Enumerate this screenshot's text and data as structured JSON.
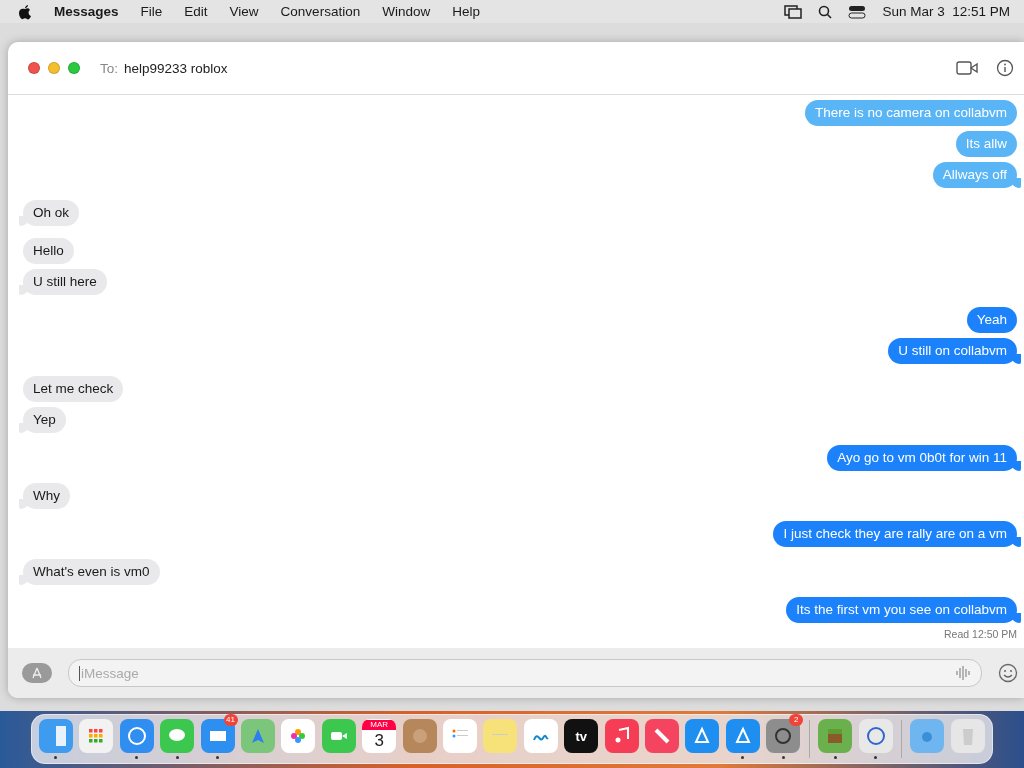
{
  "menu_bar": {
    "app": "Messages",
    "menus": [
      "File",
      "Edit",
      "View",
      "Conversation",
      "Window",
      "Help"
    ],
    "date": "Sun Mar 3",
    "time": "12:51 PM"
  },
  "window": {
    "to_label": "To:",
    "recipient": "help99233 roblox"
  },
  "message_groups": [
    {
      "messages": [
        {
          "kind": "sent",
          "text": "There is no camera on collabvm",
          "faded": true,
          "tail": false
        },
        {
          "kind": "sent",
          "text": "Its allw",
          "faded": true,
          "tail": false
        },
        {
          "kind": "sent",
          "text": "Allways off",
          "faded": true,
          "tail": true
        }
      ]
    },
    {
      "messages": [
        {
          "kind": "received",
          "text": "Oh ok",
          "tail": true
        }
      ]
    },
    {
      "messages": [
        {
          "kind": "received",
          "text": "Hello",
          "tail": false
        },
        {
          "kind": "received",
          "text": "U still here",
          "tail": true
        }
      ]
    },
    {
      "messages": [
        {
          "kind": "sent",
          "text": "Yeah",
          "faded": false,
          "tail": false
        },
        {
          "kind": "sent",
          "text": "U still on collabvm",
          "faded": false,
          "tail": true
        }
      ]
    },
    {
      "messages": [
        {
          "kind": "received",
          "text": "Let me check",
          "tail": false
        },
        {
          "kind": "received",
          "text": "Yep",
          "tail": true
        }
      ]
    },
    {
      "messages": [
        {
          "kind": "sent",
          "text": "Ayo go to vm 0b0t for win 11",
          "faded": false,
          "tail": true
        }
      ]
    },
    {
      "messages": [
        {
          "kind": "received",
          "text": "Why",
          "tail": true
        }
      ]
    },
    {
      "messages": [
        {
          "kind": "sent",
          "text": "I just check they are rally are on a vm",
          "faded": false,
          "tail": true
        }
      ]
    },
    {
      "messages": [
        {
          "kind": "received",
          "text": "What's even is vm0",
          "tail": true
        }
      ]
    },
    {
      "messages": [
        {
          "kind": "sent",
          "text": "Its the first vm you see on collabvm",
          "faded": false,
          "tail": true
        }
      ]
    }
  ],
  "read_receipt": "Read 12:50 PM",
  "composer": {
    "placeholder": "iMessage"
  },
  "dock": [
    {
      "kind": "finder",
      "running": true
    },
    {
      "kind": "launchpad",
      "running": false
    },
    {
      "kind": "safari",
      "running": true
    },
    {
      "kind": "messages",
      "running": true
    },
    {
      "kind": "mail",
      "running": true,
      "badge": "41"
    },
    {
      "kind": "maps",
      "running": false
    },
    {
      "kind": "photos",
      "running": false
    },
    {
      "kind": "facetime",
      "running": false
    },
    {
      "kind": "calendar",
      "running": false,
      "month": "MAR",
      "day": "3"
    },
    {
      "kind": "contacts",
      "running": false
    },
    {
      "kind": "reminders",
      "running": false
    },
    {
      "kind": "notes",
      "running": false
    },
    {
      "kind": "freeform",
      "running": false
    },
    {
      "kind": "tv",
      "running": false,
      "label": "tv"
    },
    {
      "kind": "music",
      "running": false
    },
    {
      "kind": "news",
      "running": false
    },
    {
      "kind": "keynote",
      "running": false
    },
    {
      "kind": "appstore",
      "running": true
    },
    {
      "kind": "settings",
      "running": true,
      "badge": "2"
    },
    {
      "kind": "separator"
    },
    {
      "kind": "minecraft",
      "running": true
    },
    {
      "kind": "findmy",
      "running": true
    },
    {
      "kind": "separator"
    },
    {
      "kind": "downloads",
      "running": false
    },
    {
      "kind": "trash",
      "running": false
    }
  ]
}
